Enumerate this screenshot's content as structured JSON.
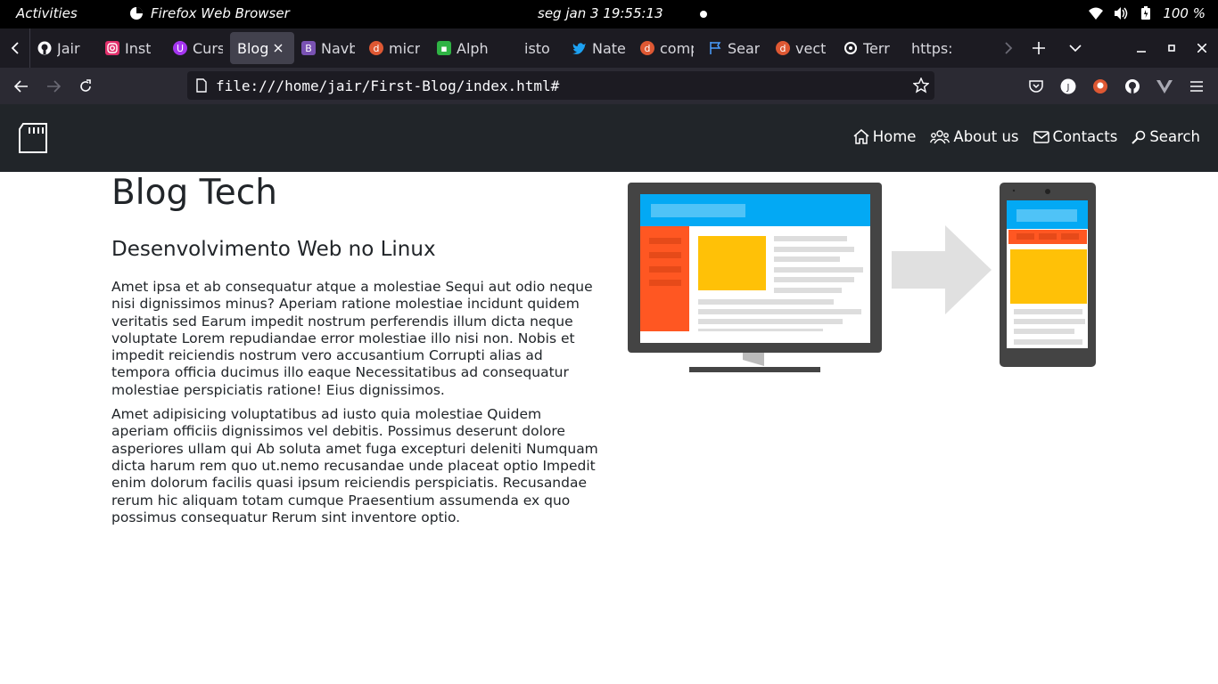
{
  "system_bar": {
    "activities": "Activities",
    "app_name": "Firefox Web Browser",
    "clock": "seg jan 3  19:55:13",
    "battery": "100 %"
  },
  "tabs": [
    {
      "title": "Jair",
      "icon": "github-icon",
      "color": "#fbfbfe"
    },
    {
      "title": "Inst",
      "icon": "instagram-icon",
      "color": "#e1306c"
    },
    {
      "title": "Curs",
      "icon": "udemy-icon",
      "color": "#a435f0"
    },
    {
      "title": "Blog",
      "icon": "",
      "active": true
    },
    {
      "title": "Navb",
      "icon": "bootstrap-icon",
      "color": "#7952b3"
    },
    {
      "title": "micr",
      "icon": "duckduckgo-icon",
      "color": "#de5833"
    },
    {
      "title": "Alph",
      "icon": "green-app-icon",
      "color": "#2fb344"
    },
    {
      "title": "isto",
      "icon": "",
      "color": ""
    },
    {
      "title": "Nate",
      "icon": "twitter-icon",
      "color": "#1da1f2"
    },
    {
      "title": "comp",
      "icon": "duckduckgo-icon",
      "color": "#de5833"
    },
    {
      "title": "Sear",
      "icon": "flag-icon",
      "color": "#4a9eff"
    },
    {
      "title": "vect",
      "icon": "duckduckgo-icon",
      "color": "#de5833"
    },
    {
      "title": "Terr",
      "icon": "openai-icon",
      "color": "#ffffff"
    },
    {
      "title": "https:",
      "icon": "",
      "color": ""
    }
  ],
  "navbar": {
    "url": "file:///home/jair/First-Blog/index.html#"
  },
  "site": {
    "menu": [
      {
        "label": "Home",
        "icon": "house-icon"
      },
      {
        "label": "About us",
        "icon": "people-icon"
      },
      {
        "label": "Contacts",
        "icon": "envelope-icon"
      },
      {
        "label": "Search",
        "icon": "search-icon"
      }
    ],
    "title": "Blog Tech",
    "subtitle": "Desenvolvimento Web no Linux",
    "paragraphs": [
      "Amet ipsa et ab consequatur atque a molestiae Sequi aut odio neque nisi dignissimos minus? Aperiam ratione molestiae incidunt quidem veritatis sed Earum impedit nostrum perferendis illum dicta neque voluptate Lorem repudiandae error molestiae illo nisi non. Nobis et impedit reiciendis nostrum vero accusantium Corrupti alias ad tempora officia ducimus illo eaque Necessitatibus ad consequatur molestiae perspiciatis ratione! Eius dignissimos.",
      "Amet adipisicing voluptatibus ad iusto quia molestiae Quidem aperiam officiis dignissimos vel debitis. Possimus deserunt dolore asperiores ullam qui Ab soluta amet fuga excepturi deleniti Numquam dicta harum rem quo ut.nemo recusandae unde placeat optio Impedit enim dolorum facilis quasi ipsum reiciendis perspiciatis. Recusandae rerum hic aliquam totam cumque Praesentium assumenda ex quo possimus consequatur Rerum sint inventore optio."
    ]
  },
  "colors": {
    "site_nav_bg": "#212529",
    "browser_chrome": "#2b2a33",
    "tabbar_bg": "#1c1b22",
    "illustration_blue": "#03a9f4",
    "illustration_orange": "#ff5722",
    "illustration_yellow": "#ffc107"
  }
}
